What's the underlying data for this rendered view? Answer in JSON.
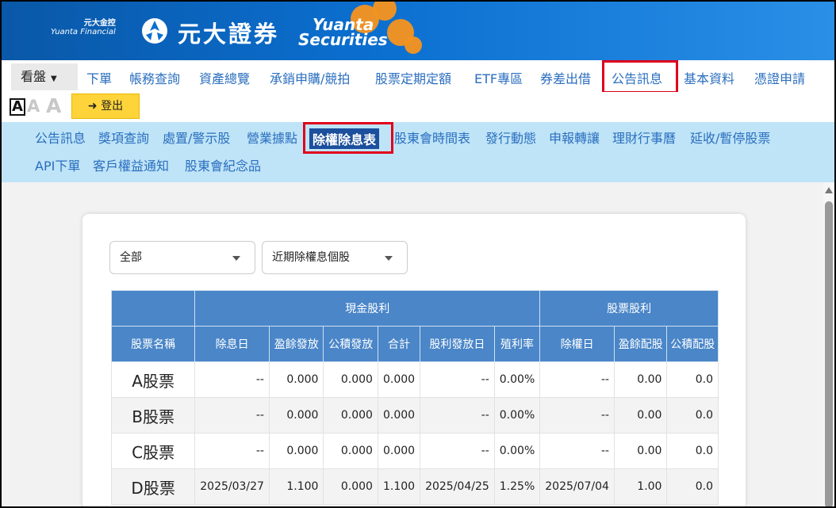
{
  "header": {
    "group_cn": "元大金控",
    "group_en": "Yuanta Financial",
    "brand_cn": "元大證券",
    "brand_en_1": "Yuanta",
    "brand_en_2": "Securities"
  },
  "main_nav": {
    "kanpan": "看盤",
    "items": [
      "下單",
      "帳務查詢",
      "資產總覽",
      "承銷申購/競拍",
      "股票定期定額",
      "ETF專區",
      "券差出借",
      "公告訊息",
      "基本資料",
      "憑證申請"
    ],
    "highlighted": "公告訊息"
  },
  "toolbar": {
    "font_sizes": [
      "A",
      "A",
      "A"
    ],
    "logout_label": "登出"
  },
  "sub_nav": {
    "row1": [
      "公告訊息",
      "獎項查詢",
      "處置/警示股",
      "營業據點",
      "除權除息表",
      "股東會時間表",
      "發行動態",
      "申報轉讓",
      "理財行事曆",
      "延收/暫停股票"
    ],
    "row2": [
      "API下單",
      "客戶權益通知",
      "股東會紀念品"
    ],
    "selected": "除權除息表"
  },
  "filters": {
    "market": "全部",
    "range": "近期除權息個股"
  },
  "table": {
    "group_headers": [
      "現金股利",
      "股票股利"
    ],
    "columns": [
      "股票名稱",
      "除息日",
      "盈餘發放",
      "公積發放",
      "合計",
      "股利發放日",
      "殖利率",
      "除權日",
      "盈餘配股",
      "公積配股"
    ],
    "rows": [
      [
        "A股票",
        "--",
        "0.000",
        "0.000",
        "0.000",
        "--",
        "0.00%",
        "--",
        "0.00",
        "0.0"
      ],
      [
        "B股票",
        "--",
        "0.000",
        "0.000",
        "0.000",
        "--",
        "0.00%",
        "--",
        "0.00",
        "0.0"
      ],
      [
        "C股票",
        "--",
        "0.000",
        "0.000",
        "0.000",
        "--",
        "0.00%",
        "--",
        "0.00",
        "0.0"
      ],
      [
        "D股票",
        "2025/03/27",
        "1.100",
        "0.000",
        "1.100",
        "2025/04/25",
        "1.25%",
        "2025/07/04",
        "1.00",
        "0.0"
      ]
    ]
  },
  "colors": {
    "highlight_box": "#e0001b",
    "link": "#2a6ebf",
    "table_header": "#4a86c8",
    "subnav_bg": "#bfe4f7",
    "logout_bg": "#ffd43b"
  }
}
